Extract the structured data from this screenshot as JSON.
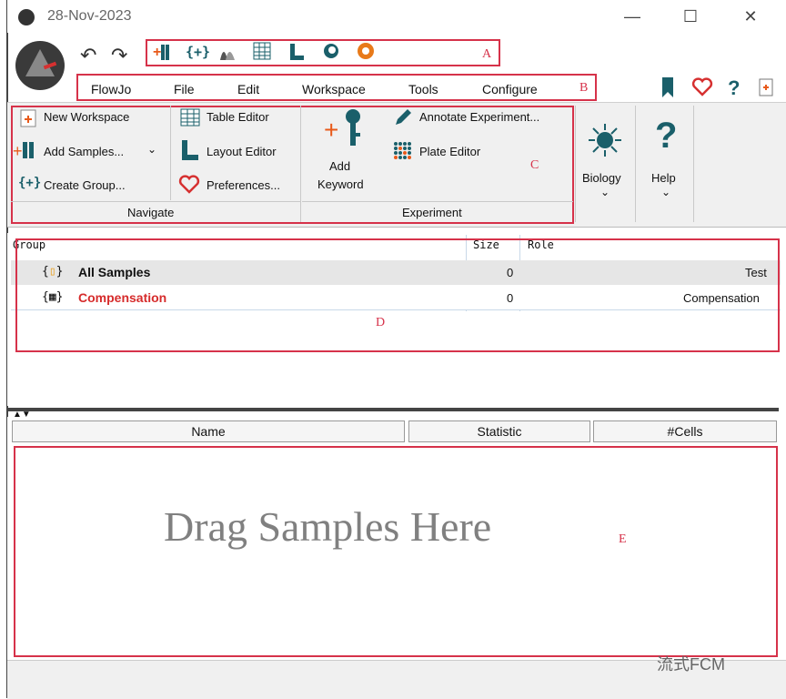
{
  "window": {
    "title": "28-Nov-2023",
    "minimize": "—",
    "maximize": "☐",
    "close": "✕"
  },
  "quick_toolbar": {
    "undo": "↶",
    "redo": "↷",
    "label": "A"
  },
  "menu": {
    "items": [
      "FlowJo",
      "File",
      "Edit",
      "Workspace",
      "Tools",
      "Configure"
    ],
    "label": "B",
    "right_icons": [
      "bookmark-icon",
      "heart-icon",
      "help-icon",
      "document-icon"
    ],
    "help_glyph": "?"
  },
  "ribbon": {
    "navigate": {
      "group_label": "Navigate",
      "new_workspace": "New Workspace",
      "add_samples": "Add Samples...",
      "create_group": "Create Group...",
      "table_editor": "Table Editor",
      "layout_editor": "Layout Editor",
      "preferences": "Preferences..."
    },
    "experiment": {
      "group_label": "Experiment",
      "add_keyword_1": "Add",
      "add_keyword_2": "Keyword",
      "annotate": "Annotate Experiment...",
      "plate_editor": "Plate Editor"
    },
    "label": "C",
    "biology": "Biology",
    "help": "Help"
  },
  "groups_table": {
    "headers": {
      "group": "Group",
      "size": "Size",
      "role": "Role"
    },
    "rows": [
      {
        "name": "All Samples",
        "size": "0",
        "role": "Test"
      },
      {
        "name": "Compensation",
        "size": "0",
        "role": "Compensation"
      }
    ],
    "label": "D"
  },
  "stats_table": {
    "headers": {
      "name": "Name",
      "statistic": "Statistic",
      "cells": "#Cells"
    },
    "placeholder": "Drag Samples Here",
    "label": "E"
  },
  "watermark": "流式FCM",
  "colors": {
    "annotation_red": "#d6324a",
    "accent_orange": "#e85a1a",
    "teal": "#1a5f6a",
    "comp_red": "#d62b2b"
  }
}
